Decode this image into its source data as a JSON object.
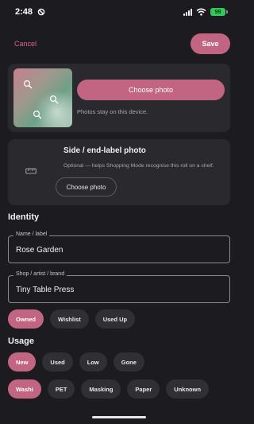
{
  "status_bar": {
    "time": "2:48",
    "battery": "99",
    "icons": [
      "do-not-disturb-icon",
      "signal-icon",
      "wifi-icon",
      "battery-icon"
    ]
  },
  "toolbar": {
    "cancel_label": "Cancel",
    "save_label": "Save"
  },
  "photo": {
    "choose_label": "Choose photo",
    "note": "Photos stay on this device."
  },
  "side_photo": {
    "title": "Side / end-label photo",
    "hint": "Optional — helps Shopping Mode recognise this roll on a shelf.",
    "choose_label": "Choose photo",
    "icon": "ruler-icon"
  },
  "identity": {
    "title": "Identity",
    "name_label": "Name / label",
    "name_value": "Rose Garden",
    "shop_label": "Shop / artist / brand",
    "shop_value": "Tiny Table Press"
  },
  "ownership": {
    "options": [
      "Owned",
      "Wishlist",
      "Used Up"
    ],
    "selected": "Owned"
  },
  "usage": {
    "title": "Usage",
    "state_options": [
      "New",
      "Used",
      "Low",
      "Gone"
    ],
    "state_selected": "New",
    "type_options": [
      "Washi",
      "PET",
      "Masking",
      "Paper",
      "Unknown"
    ],
    "type_selected": "Washi"
  },
  "colors": {
    "accent": "#c26583",
    "background": "#1c1b1f",
    "card": "#2a292e",
    "chip": "#302f34"
  }
}
